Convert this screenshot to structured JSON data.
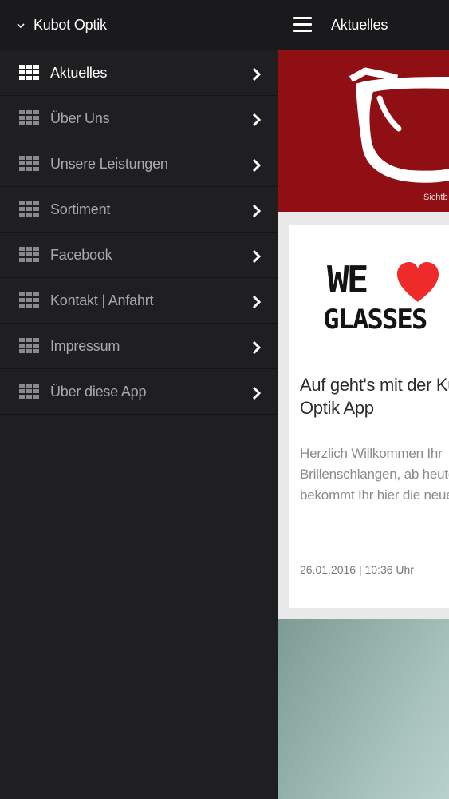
{
  "drawer": {
    "app_title": "Kubot Optik",
    "items": [
      {
        "label": "Aktuelles",
        "active": true
      },
      {
        "label": "Über Uns",
        "active": false
      },
      {
        "label": "Unsere Leistungen",
        "active": false
      },
      {
        "label": "Sortiment",
        "active": false
      },
      {
        "label": "Facebook",
        "active": false
      },
      {
        "label": "Kontakt | Anfahrt",
        "active": false
      },
      {
        "label": "Impressum",
        "active": false
      },
      {
        "label": "Über diese App",
        "active": false
      }
    ]
  },
  "topbar": {
    "title": "Aktuelles",
    "menu_icon": "hamburger-icon"
  },
  "banner": {
    "claim": "Sichtb"
  },
  "article": {
    "image_line1": "WE",
    "image_line2": "GLASSES",
    "headline": "Auf geht's mit der Kubot Optik App",
    "excerpt": "Herzlich Willkommen Ihr Brillenschlangen, ab heute bekommt Ihr hier die neuesten ...",
    "date": "26.01.2016 | 10:36 Uhr"
  },
  "colors": {
    "drawer_bg": "#1f1f21",
    "header_bg": "#1a1a1c",
    "banner_red": "#8f0f14",
    "heart_red": "#ee2a2a"
  }
}
